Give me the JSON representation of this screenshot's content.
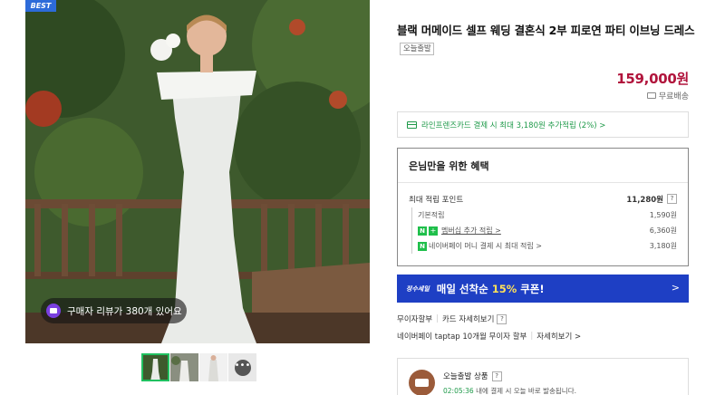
{
  "image": {
    "badge": "BEST",
    "review_text": "구매자 리뷰가 380개 있어요",
    "thumbnails": [
      "thumb-1",
      "thumb-2",
      "thumb-3",
      "thumb-4"
    ]
  },
  "product": {
    "title": "블랙 머메이드 셀프 웨딩 결혼식 2부 피로연 파티 이브닝 드레스",
    "tag": "오늘출발",
    "price": "159,000원",
    "shipping": "무료배송"
  },
  "card_promo": {
    "text": "라인프렌즈카드 결제 시 최대 3,180원 추가적립 (2%) >"
  },
  "benefits": {
    "header": "은님만을 위한 혜택",
    "main_label": "최대 적립 포인트",
    "main_value": "11,280원",
    "rows": [
      {
        "label": "기본적립",
        "value": "1,590원"
      },
      {
        "label": "멤버십 추가 적립 >",
        "value": "6,360원"
      },
      {
        "label": "네이버페이 머니 결제 시 최대 적립 >",
        "value": "3,180원"
      }
    ],
    "help_icon": "?"
  },
  "coupon": {
    "logo": "정수세일",
    "text_prefix": "매일 선착순 ",
    "text_highlight": "15%",
    "text_suffix": " 쿠폰!",
    "arrow": ">"
  },
  "options": {
    "row1": [
      "무이자할부",
      "카드 자세히보기"
    ],
    "row2": [
      "네이버페이 taptap 10개월 무이자 할부",
      "자세히보기 >"
    ]
  },
  "today_ship": {
    "title": "오늘출발 상품",
    "sub_time": "02:05:36",
    "sub_text": " 내에 결제 시 오늘 바로 발송됩니다."
  },
  "colors": {
    "price": "#b1143c",
    "accent_green": "#1f9a4a",
    "coupon_bg": "#1e3fc4",
    "best_badge": "#2d6bd9"
  }
}
